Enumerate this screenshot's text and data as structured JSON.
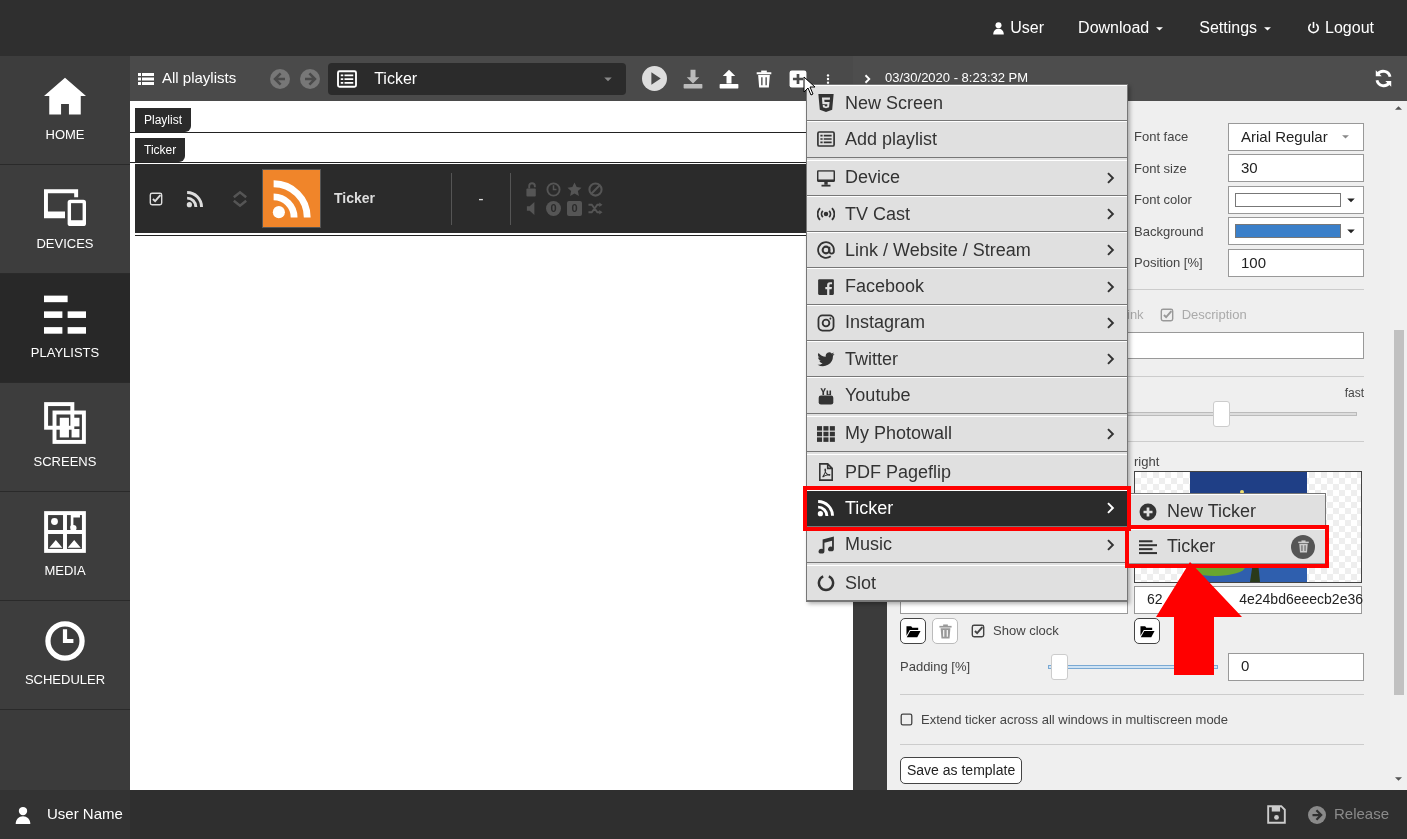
{
  "top_bar": {
    "items": [
      {
        "label": "User",
        "kind": "user"
      },
      {
        "label": "Download",
        "kind": "dropdown"
      },
      {
        "label": "Settings",
        "kind": "dropdown"
      },
      {
        "label": "Logout",
        "kind": "logout"
      }
    ]
  },
  "sidebar": {
    "items": [
      {
        "label": "HOME",
        "selected": false
      },
      {
        "label": "DEVICES",
        "selected": false
      },
      {
        "label": "PLAYLISTS",
        "selected": true
      },
      {
        "label": "SCREENS",
        "selected": false
      },
      {
        "label": "MEDIA",
        "selected": false
      },
      {
        "label": "SCHEDULER",
        "selected": false
      }
    ]
  },
  "toolbar": {
    "all_playlists": "All playlists",
    "history_buttons": [
      {
        "kind": "back",
        "disabled": true
      },
      {
        "kind": "forward",
        "disabled": true
      }
    ],
    "playlist_select": {
      "value": "Ticker"
    }
  },
  "section_labels": [
    "Playlist",
    "Ticker"
  ],
  "playlist_items": [
    {
      "checked": true,
      "title": "Ticker",
      "duration": "-",
      "counters": [
        "0",
        "0"
      ]
    }
  ],
  "right_panel": {
    "date": "03/30/2020 - 8:23:32 PM",
    "fields": [
      {
        "label": "Font face",
        "kind": "select",
        "value": "Arial Regular"
      },
      {
        "label": "Font size",
        "kind": "text",
        "value": "30"
      },
      {
        "label": "Font color",
        "kind": "color",
        "color": "#ffffff"
      },
      {
        "label": "Background",
        "kind": "color",
        "color": "#3a7fc9"
      },
      {
        "label": "Position [%]",
        "kind": "text",
        "value": "100"
      }
    ],
    "link_option": {
      "label": "ink"
    },
    "description_option": {
      "label": "Description",
      "checked": true
    },
    "speed": {
      "label": "fast",
      "level": 0.7
    },
    "image_label": "right",
    "image_id": {
      "start": "62",
      "end": "4e24bd6eeecb2e36"
    },
    "show_clock": {
      "label": "Show clock",
      "checked": true
    },
    "padding": {
      "label": "Padding [%]",
      "level": 0.02,
      "value": "0"
    },
    "extend_option": {
      "label": "Extend ticker across all windows in multiscreen mode",
      "checked": false
    },
    "save_button": "Save as template"
  },
  "add_menu": {
    "items": [
      {
        "label": "New Screen",
        "has_submenu": false,
        "selected": false,
        "highlighted": false
      },
      {
        "label": "Add playlist",
        "has_submenu": false,
        "selected": false,
        "highlighted": false
      },
      {
        "label": "Device",
        "has_submenu": true,
        "selected": false,
        "highlighted": false
      },
      {
        "label": "TV Cast",
        "has_submenu": true,
        "selected": false,
        "highlighted": false
      },
      {
        "label": "Link / Website / Stream",
        "has_submenu": true,
        "selected": false,
        "highlighted": false
      },
      {
        "label": "Facebook",
        "has_submenu": true,
        "selected": false,
        "highlighted": false
      },
      {
        "label": "Instagram",
        "has_submenu": true,
        "selected": false,
        "highlighted": false
      },
      {
        "label": "Twitter",
        "has_submenu": true,
        "selected": false,
        "highlighted": false
      },
      {
        "label": "Youtube",
        "has_submenu": false,
        "selected": false,
        "highlighted": false
      },
      {
        "label": "My Photowall",
        "has_submenu": true,
        "selected": false,
        "highlighted": false
      },
      {
        "label": "PDF Pageflip",
        "has_submenu": false,
        "selected": false,
        "highlighted": false
      },
      {
        "label": "Ticker",
        "has_submenu": true,
        "selected": true,
        "highlighted": true
      },
      {
        "label": "Music",
        "has_submenu": true,
        "selected": false,
        "highlighted": false
      },
      {
        "label": "Slot",
        "has_submenu": false,
        "selected": false,
        "highlighted": false
      }
    ]
  },
  "ticker_submenu": {
    "items": [
      {
        "label": "New Ticker",
        "kind": "new",
        "highlighted": false
      },
      {
        "label": "Ticker",
        "kind": "existing",
        "highlighted": true
      }
    ]
  },
  "bottom_bar": {
    "user": "User Name",
    "release": {
      "label": "Release",
      "disabled": true
    }
  }
}
